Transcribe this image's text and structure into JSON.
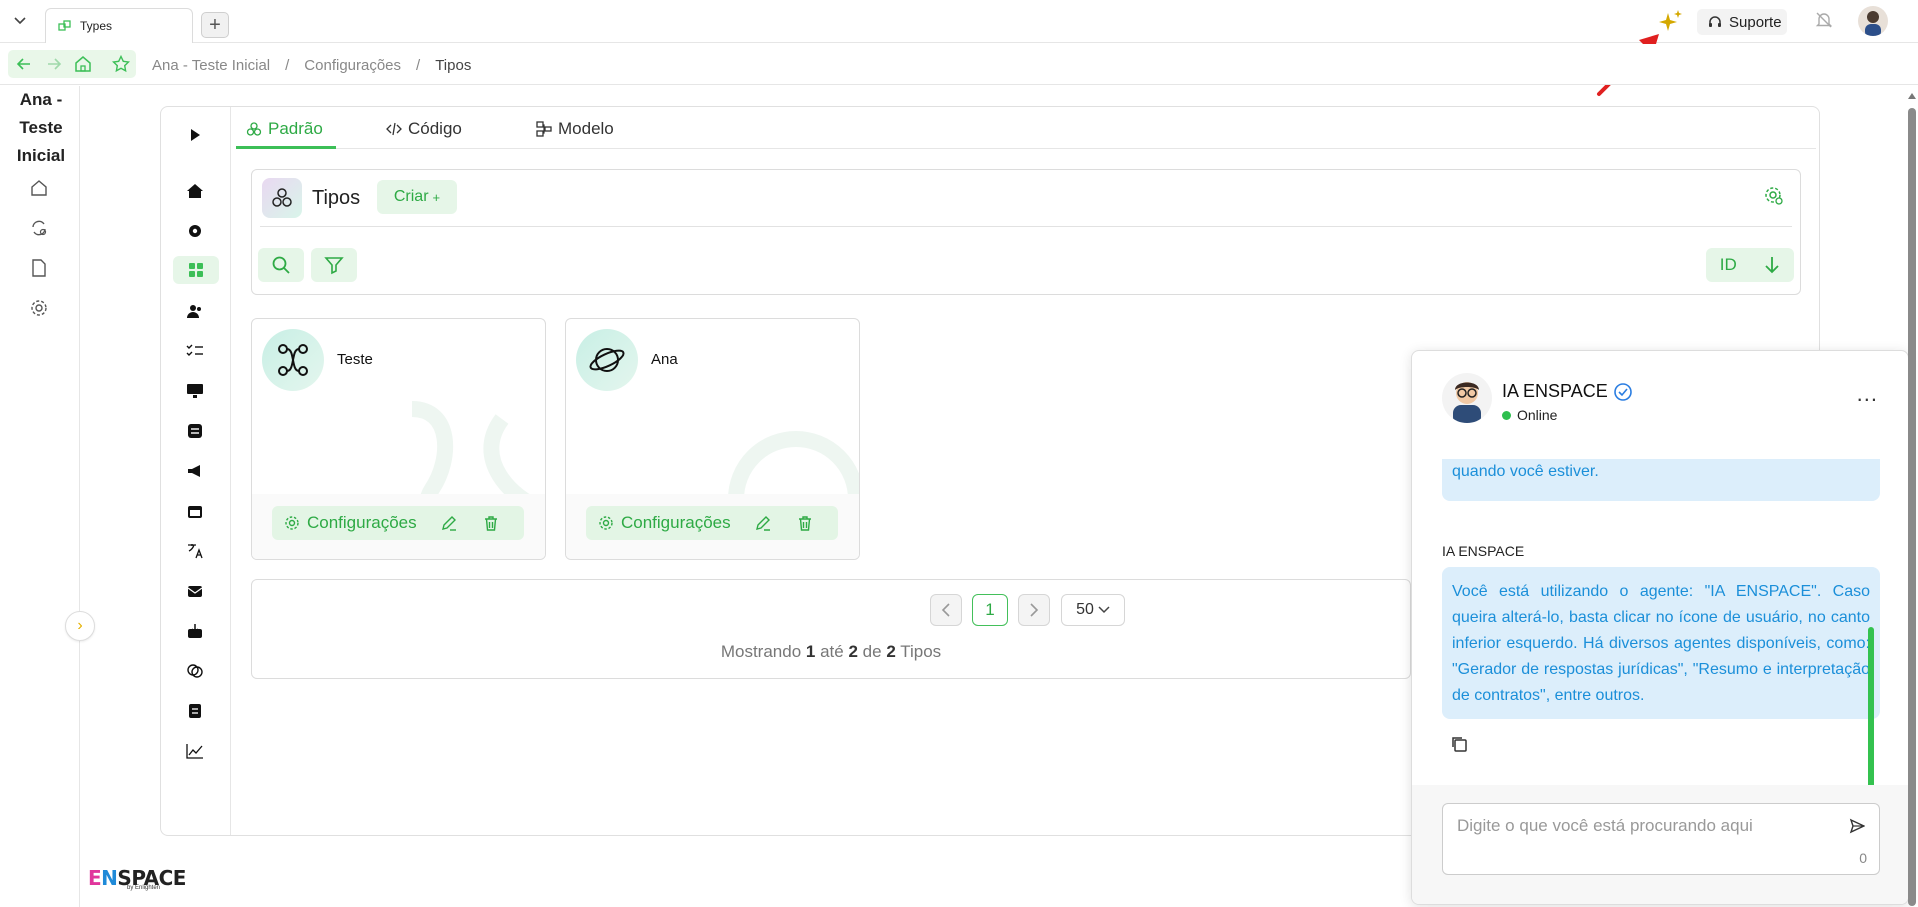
{
  "browser": {
    "tab_title": "Types",
    "new_tab": "+",
    "support_label": "Suporte"
  },
  "breadcrumb": {
    "items": [
      "Ana - Teste Inicial",
      "/",
      "Configurações",
      "/",
      "Tipos"
    ]
  },
  "sidebar": {
    "project_name": "Ana - Teste Inicial",
    "logo_text": "ENSPACE",
    "logo_sub": "by Enlighten",
    "collapse": "›"
  },
  "main": {
    "tabs": [
      {
        "label": "Padrão",
        "active": true
      },
      {
        "label": "Código",
        "active": false
      },
      {
        "label": "Modelo",
        "active": false
      }
    ],
    "panel_title": "Tipos",
    "create_label": "Criar",
    "create_plus": "+",
    "sort_label": "ID"
  },
  "cards": [
    {
      "title": "Teste",
      "config_label": "Configurações",
      "icon": "graph-nodes-icon"
    },
    {
      "title": "Ana",
      "config_label": "Configurações",
      "icon": "planet-icon"
    }
  ],
  "pagination": {
    "current_page": "1",
    "page_size": "50",
    "info_prefix": "Mostrando",
    "from": "1",
    "mid1": "até",
    "to": "2",
    "mid2": "de",
    "total": "2",
    "suffix": "Tipos"
  },
  "chat": {
    "bot_name": "IA ENSPACE",
    "status": "Online",
    "more": "...",
    "previous_message": "quando você estiver.",
    "sender": "IA ENSPACE",
    "message": "Você está utilizando o agente: \"IA ENSPACE\". Caso queira alterá-lo, basta clicar no ícone de usuário, no canto inferior esquerdo. Há diversos agentes disponíveis, como: \"Gerador de respostas jurídicas\", \"Resumo e interpretação de contratos\", entre outros.",
    "input_placeholder": "Digite o que você está procurando aqui",
    "char_count": "0"
  },
  "colors": {
    "accent": "#3cbf57",
    "accent_bg": "#e6f6e8",
    "chat_bubble": "#dceefb",
    "chat_text": "#1b8fd9",
    "arrow": "#e02020",
    "sparkle": "#d4a800"
  }
}
